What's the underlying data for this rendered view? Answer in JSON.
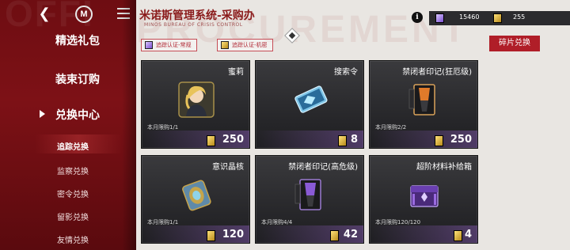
{
  "nav": {
    "back_icon": "back-arrow-icon",
    "home_icon": "home-icon",
    "home_label": "M",
    "menu_icon": "menu-icon"
  },
  "sidebar": {
    "items": [
      {
        "label": "精选礼包"
      },
      {
        "label": "装束订购"
      },
      {
        "label": "兑换中心"
      }
    ],
    "sub_items": [
      {
        "label": "追踪兑换"
      },
      {
        "label": "监察兑换"
      },
      {
        "label": "密令兑换"
      },
      {
        "label": "留影兑换"
      },
      {
        "label": "友情兑换"
      }
    ],
    "watermark": "OFFI"
  },
  "header": {
    "title": "米诺斯管理系统-采购办",
    "subtitle": "MINOS BUREAU OF CRISIS CONTROL",
    "bg_text": "PROCUREMENT"
  },
  "resources": {
    "info_label": "i",
    "purple_value": "15460",
    "gold_value": "255",
    "purple_icon": "purple-tracking-cert-icon",
    "gold_icon": "gold-tracking-cert-icon"
  },
  "tags": [
    {
      "label": "追踪认证-常规",
      "icon": "purple-tracking-cert-icon"
    },
    {
      "label": "追踪认证-机密",
      "icon": "gold-tracking-cert-icon"
    }
  ],
  "fragment_button": "碎片兑换",
  "cards": [
    {
      "name": "蜜莉",
      "limit": "本月限购1/1",
      "price": "250",
      "art": "character-portrait-icon"
    },
    {
      "name": "搜索令",
      "limit": "",
      "price": "8",
      "art": "search-order-card-icon"
    },
    {
      "name": "禁闭者印记(狂厄级)",
      "limit": "本月限购2/2",
      "price": "250",
      "art": "sinner-mark-frenzied-icon"
    },
    {
      "name": "意识晶核",
      "limit": "本月限购1/1",
      "price": "120",
      "art": "consciousness-crystal-icon"
    },
    {
      "name": "禁闭者印记(高危级)",
      "limit": "本月限购4/4",
      "price": "42",
      "art": "sinner-mark-high-risk-icon"
    },
    {
      "name": "超阶材料补给箱",
      "limit": "本月限购120/120",
      "price": "4",
      "art": "supply-box-icon"
    }
  ],
  "colors": {
    "sidebar_red": "#7d1116",
    "accent_red": "#b01e28",
    "card_dark": "#2a2a2d",
    "currency_gold": "#d9b23a",
    "currency_purple": "#8b5cd6"
  }
}
